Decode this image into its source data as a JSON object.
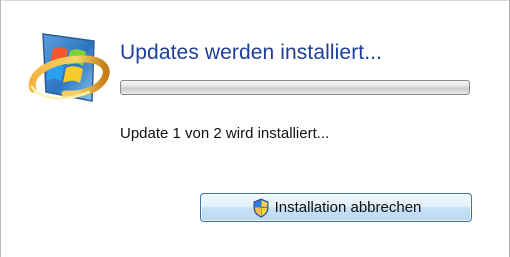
{
  "dialog": {
    "title": "Updates werden installiert...",
    "progress_fraction": 0.0,
    "status": "Update 1 von 2 wird installiert...",
    "cancel_button_label": "Installation abbrechen"
  },
  "icons": {
    "main": "windows-update-icon",
    "button": "shield-icon"
  },
  "colors": {
    "title": "#1e3f9a",
    "button_border": "#3b72a8",
    "progress_track": "#d9d9d9"
  }
}
